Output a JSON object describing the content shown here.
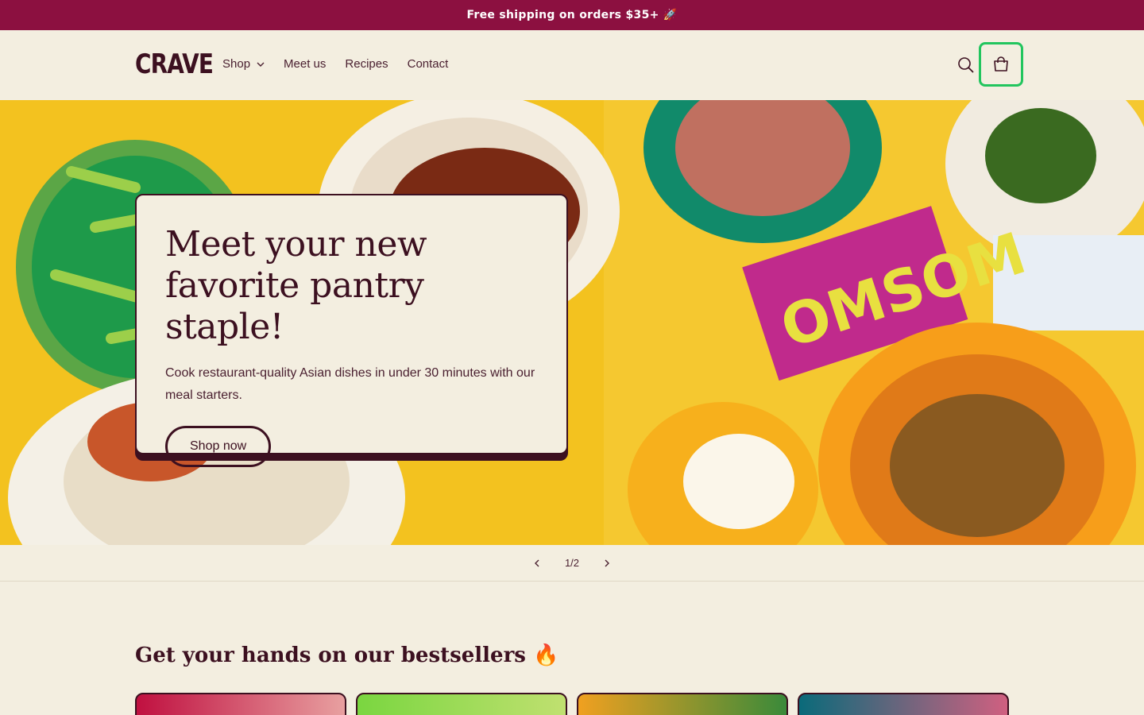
{
  "announcement": {
    "text": "Free shipping on orders $35+ 🚀"
  },
  "header": {
    "logo": "CRAVE",
    "nav": [
      {
        "label": "Shop",
        "has_dropdown": true
      },
      {
        "label": "Meet us"
      },
      {
        "label": "Recipes"
      },
      {
        "label": "Contact"
      }
    ],
    "search_icon": "search-icon",
    "cart_icon": "cart-icon"
  },
  "hero": {
    "title": "Meet your new favorite pantry staple!",
    "subtitle": "Cook restaurant-quality Asian dishes in under 30 minutes with our meal starters.",
    "cta": "Shop now"
  },
  "slider": {
    "counter": "1/2"
  },
  "bestsellers": {
    "title": "Get your hands on our bestsellers 🔥"
  },
  "colors": {
    "brand": "#8c1040",
    "text": "#3c1020",
    "background": "#f3eee0",
    "focus": "#22c55e"
  }
}
